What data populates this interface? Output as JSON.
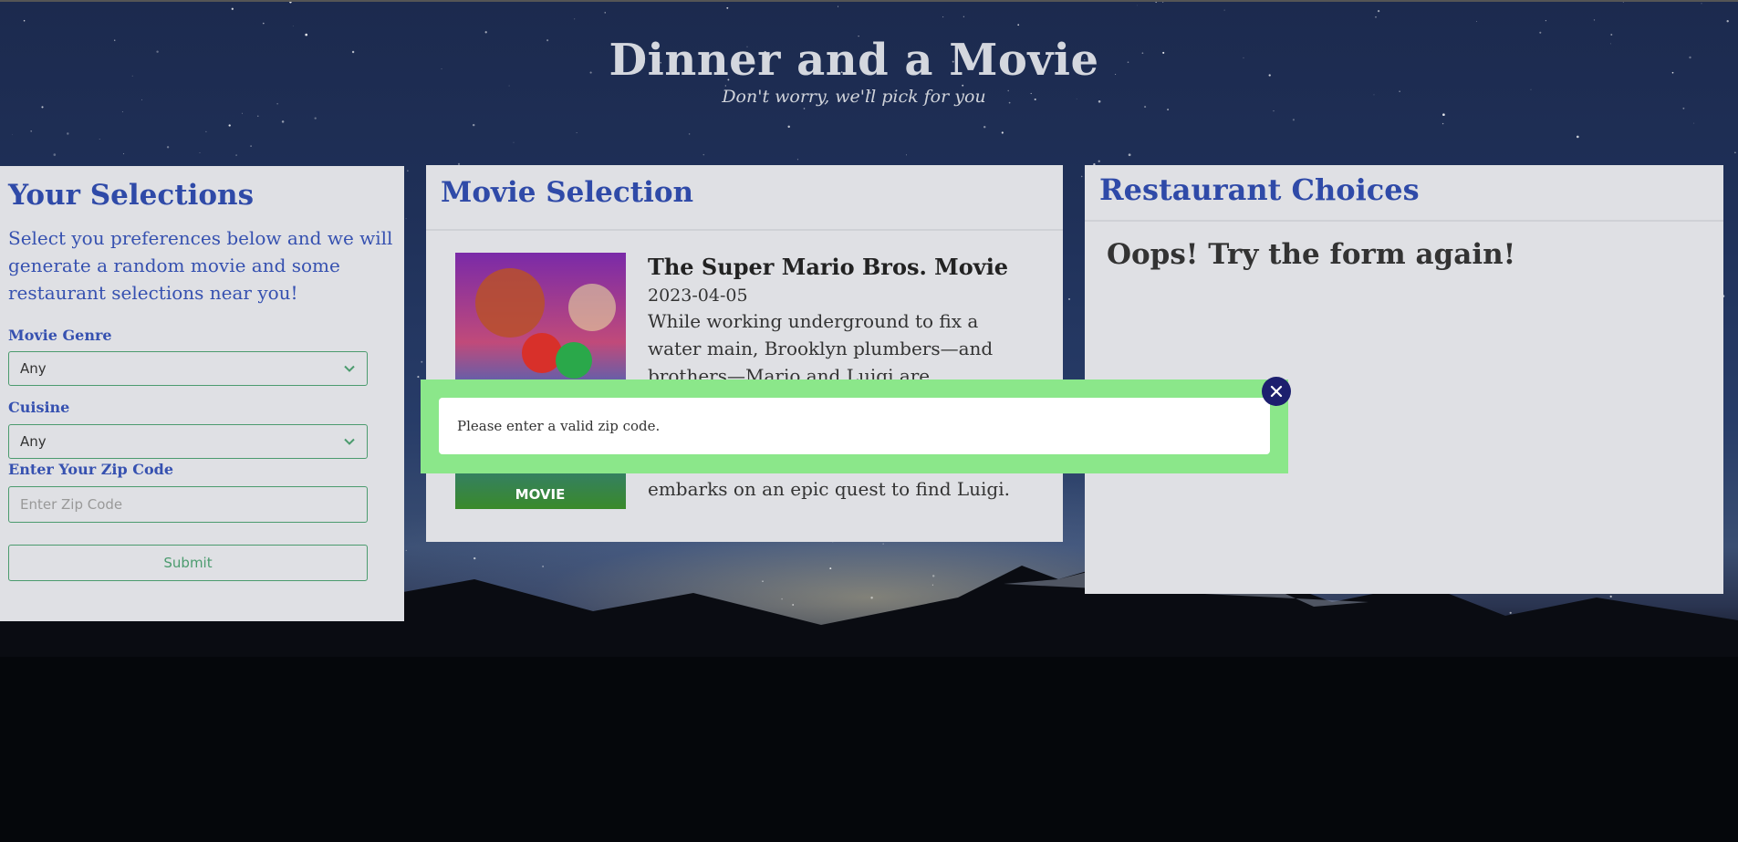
{
  "header": {
    "title": "Dinner and a Movie",
    "subtitle": "Don't worry, we'll pick for you"
  },
  "selections": {
    "title": "Your Selections",
    "intro": "Select you preferences below and we will generate a random movie and some restaurant selections near you!",
    "genre_label": "Movie Genre",
    "genre_value": "Any",
    "cuisine_label": "Cuisine",
    "cuisine_value": "Any",
    "zip_label": "Enter Your Zip Code",
    "zip_placeholder": "Enter Zip Code",
    "submit_label": "Submit"
  },
  "movie": {
    "title": "Movie Selection",
    "film_title": "The Super Mario Bros. Movie",
    "release_date": "2023-04-05",
    "overview_top": "While working underground to fix a water main, Brooklyn plumbers—and brothers—Mario and Luigi are",
    "overview_bottom": "embarks on an epic quest to find Luigi.",
    "poster_text": "MOVIE"
  },
  "restaurants": {
    "title": "Restaurant Choices",
    "message": "Oops! Try the form again!"
  },
  "modal": {
    "message": "Please enter a valid zip code."
  },
  "colors": {
    "accent_blue": "#2f4aa8",
    "input_green": "#4b9b6e",
    "modal_green": "#8be78a",
    "close_navy": "#1c1f6e"
  },
  "icons": {
    "select_arrow": "chevron-down-icon",
    "close": "close-icon"
  }
}
